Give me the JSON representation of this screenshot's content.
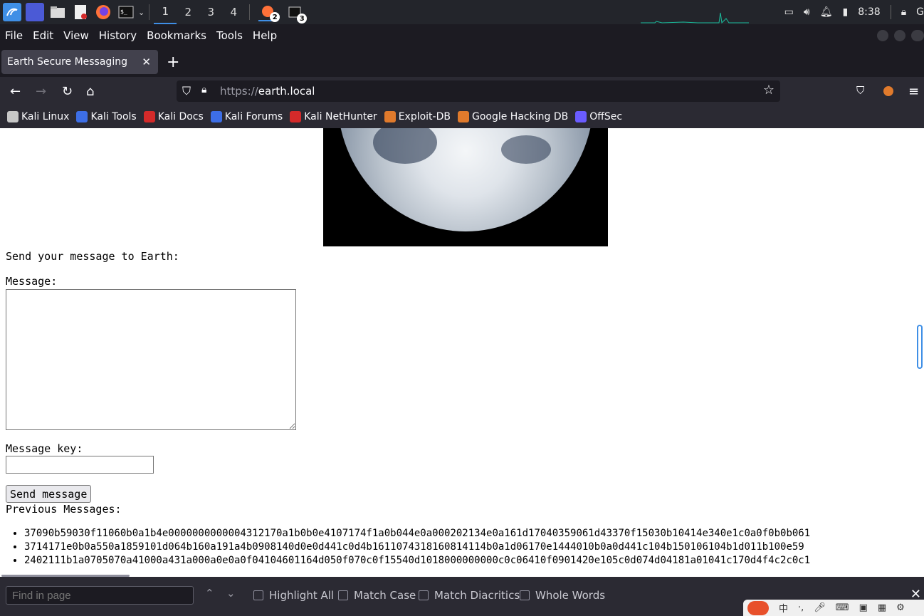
{
  "taskbar": {
    "workspaces": [
      "1",
      "2",
      "3",
      "4"
    ],
    "badges": [
      "2",
      "3"
    ],
    "clock": "8:38"
  },
  "menubar": {
    "items": [
      "File",
      "Edit",
      "View",
      "History",
      "Bookmarks",
      "Tools",
      "Help"
    ]
  },
  "tab": {
    "title": "Earth Secure Messaging",
    "close": "✕",
    "new_tab": "+"
  },
  "navbar": {
    "url_protocol": "https://",
    "url_host": "earth.local"
  },
  "bookmarks": [
    {
      "label": "Kali Linux",
      "color": "#c7c7c7"
    },
    {
      "label": "Kali Tools",
      "color": "#3d6ee6"
    },
    {
      "label": "Kali Docs",
      "color": "#d42a2a"
    },
    {
      "label": "Kali Forums",
      "color": "#3d6ee6"
    },
    {
      "label": "Kali NetHunter",
      "color": "#d42a2a"
    },
    {
      "label": "Exploit-DB",
      "color": "#e07a2c"
    },
    {
      "label": "Google Hacking DB",
      "color": "#e07a2c"
    },
    {
      "label": "OffSec",
      "color": "#6a5cff"
    }
  ],
  "page": {
    "send_heading": "Send your message to Earth:",
    "message_label": "Message:",
    "key_label": "Message key:",
    "send_button": "Send message",
    "previous_heading": "Previous Messages:",
    "messages": [
      "37090b59030f11060b0a1b4e0000000000004312170a1b0b0e4107174f1a0b044e0a000202134e0a161d17040359061d43370f15030b10414e340e1c0a0f0b0b061",
      "3714171e0b0a550a1859101d064b160a191a4b0908140d0e0d441c0d4b1611074318160814114b0a1d06170e1444010b0a0d441c104b150106104b1d011b100e59",
      "2402111b1a0705070a41000a431a000a0e0a0f04104601164d050f070c0f15540d1018000000000c0c06410f0901420e105c0d074d04181a01041c170d4f4c2c0c1"
    ]
  },
  "findbar": {
    "placeholder": "Find in page",
    "options": [
      "Highlight All",
      "Match Case",
      "Match Diacritics",
      "Whole Words"
    ]
  }
}
